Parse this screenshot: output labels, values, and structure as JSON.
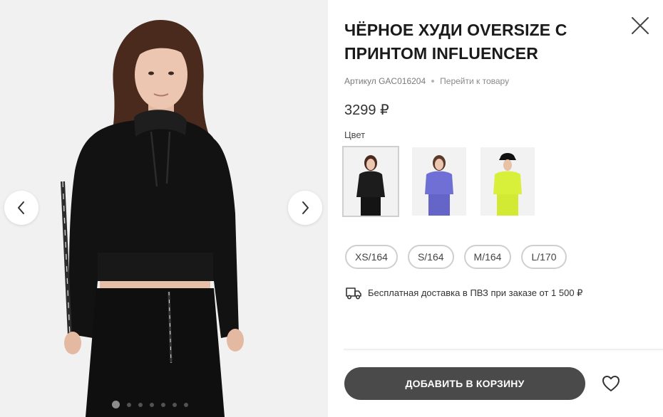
{
  "product": {
    "title": "ЧЁРНОЕ ХУДИ OVERSIZE С ПРИНТОМ INFLUENCER",
    "sku_label": "Артикул",
    "sku_value": "GAC016204",
    "go_to_product_label": "Перейти к товару",
    "price": "3299 ₽",
    "color_label": "Цвет"
  },
  "gallery": {
    "photo_count": 7,
    "active_index": 0,
    "prev_icon": "chevron-left-icon",
    "next_icon": "chevron-right-icon"
  },
  "swatches": [
    {
      "name": "black",
      "color": "#1c1c1c",
      "selected": true
    },
    {
      "name": "violet",
      "color": "#6f6fd6",
      "selected": false
    },
    {
      "name": "lime",
      "color": "#d8f03a",
      "selected": false
    }
  ],
  "sizes": [
    "XS/164",
    "S/164",
    "M/164",
    "L/170"
  ],
  "delivery": {
    "icon": "truck-icon",
    "text": "Бесплатная доставка в ПВЗ при заказе от 1 500 ₽"
  },
  "actions": {
    "add_to_cart_label": "ДОБАВИТЬ В КОРЗИНУ",
    "favorite_icon": "heart-icon",
    "close_icon": "close-icon"
  },
  "colors": {
    "cart_button_bg": "#4a4a4a",
    "gallery_bg": "#f1f1f1",
    "pill_border": "#cfcfcf"
  }
}
